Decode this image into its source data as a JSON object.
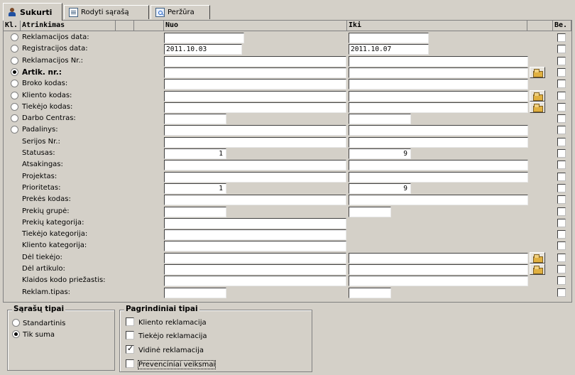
{
  "tabs": [
    {
      "label": "Sukurti",
      "icon": "user-icon",
      "active": true
    },
    {
      "label": "Rodyti sąrašą",
      "icon": "list-icon",
      "active": false
    },
    {
      "label": "Peržūra",
      "icon": "preview-icon",
      "active": false
    }
  ],
  "grid": {
    "headers": {
      "kl": "Kl.",
      "atrinkimas": "Atrinkimas",
      "nuo": "Nuo",
      "iki": "Iki",
      "be": "Be."
    },
    "rows": [
      {
        "label": "Reklamacijos data:",
        "radio": true,
        "selected": false,
        "nuo": "",
        "iki": ""
      },
      {
        "label": "Registracijos data:",
        "radio": true,
        "selected": false,
        "nuo": "2011.10.03",
        "iki": "2011.10.07"
      },
      {
        "label": "Reklamacijos Nr.:",
        "radio": true,
        "selected": false,
        "nuo": "",
        "iki": ""
      },
      {
        "label": "Artik. nr.:",
        "radio": true,
        "selected": true,
        "nuo": "",
        "iki": ""
      },
      {
        "label": "Broko kodas:",
        "radio": true,
        "selected": false,
        "nuo": "",
        "iki": ""
      },
      {
        "label": "Kliento kodas:",
        "radio": true,
        "selected": false,
        "nuo": "",
        "iki": ""
      },
      {
        "label": "Tiekėjo kodas:",
        "radio": true,
        "selected": false,
        "nuo": "",
        "iki": ""
      },
      {
        "label": "Darbo Centras:",
        "radio": true,
        "selected": false,
        "nuo": "",
        "iki": ""
      },
      {
        "label": "Padalinys:",
        "radio": true,
        "selected": false,
        "nuo": "",
        "iki": ""
      },
      {
        "label": "Serijos Nr.:",
        "radio": false,
        "nuo": "",
        "iki": ""
      },
      {
        "label": "Statusas:",
        "radio": false,
        "nuo": "1",
        "iki": "9"
      },
      {
        "label": "Atsakingas:",
        "radio": false,
        "nuo": "",
        "iki": ""
      },
      {
        "label": "Projektas:",
        "radio": false,
        "nuo": "",
        "iki": ""
      },
      {
        "label": "Prioritetas:",
        "radio": false,
        "nuo": "1",
        "iki": "9"
      },
      {
        "label": "Prekės kodas:",
        "radio": false,
        "nuo": "",
        "iki": ""
      },
      {
        "label": "Prekių grupė:",
        "radio": false,
        "nuo": "",
        "iki": ""
      },
      {
        "label": "Prekių kategorija:",
        "radio": false,
        "nuo": "",
        "iki": ""
      },
      {
        "label": "Tiekėjo kategorija:",
        "radio": false,
        "nuo": "",
        "iki": ""
      },
      {
        "label": "Kliento kategorija:",
        "radio": false,
        "nuo": "",
        "iki": ""
      },
      {
        "label": "Dėl tiekėjo:",
        "radio": false,
        "nuo": "",
        "iki": ""
      },
      {
        "label": "Dėl artikulo:",
        "radio": false,
        "nuo": "",
        "iki": ""
      },
      {
        "label": "Klaidos kodo priežastis:",
        "radio": false,
        "nuo": "",
        "iki": ""
      },
      {
        "label": "Reklam.tipas:",
        "radio": false,
        "nuo": "",
        "iki": ""
      }
    ]
  },
  "list_types": {
    "title": "Sąrašų tipai",
    "options": [
      {
        "label": "Standartinis",
        "selected": false
      },
      {
        "label": "Tik suma",
        "selected": true
      }
    ]
  },
  "main_types": {
    "title": "Pagrindiniai tipai",
    "options": [
      {
        "label": "Kliento reklamacija",
        "checked": false
      },
      {
        "label": "Tiekėjo reklamacija",
        "checked": false
      },
      {
        "label": "Vidinė reklamacija",
        "checked": true
      },
      {
        "label": "Prevenciniai veiksmai",
        "checked": false
      }
    ]
  }
}
